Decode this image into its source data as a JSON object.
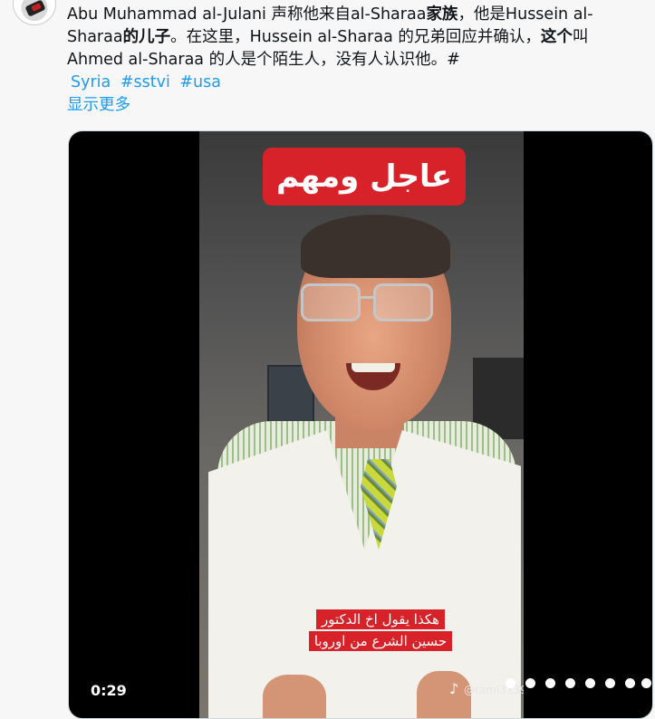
{
  "tweet": {
    "text_seg1": "Abu Muhammad al-Julani 声称他来自al-Sharaa",
    "text_bold1": "家族",
    "text_seg2": "，他是Hussein al-Sharaa",
    "text_bold2": "的儿子",
    "text_seg3": "。在这里，Hussein al-Sharaa 的兄弟回应并确认，",
    "text_bold3": "这个",
    "text_seg4": "叫Ahmed al-Sharaa 的人是个陌生人，没有人认识他。#",
    "hashtags": [
      "Syria",
      "#sstvi",
      "#usa"
    ],
    "show_more": "显示更多"
  },
  "video": {
    "banner_text": "عاجل ومهم",
    "caption_line1": "هكذا يقول اخ الدكتور",
    "caption_line2": "حسين الشرع من اوروبا",
    "watermark_handle": "@rami31397",
    "duration": "0:29"
  },
  "icons": {
    "avatar": "avatar-image",
    "tiktok": "tiktok-note-icon"
  }
}
